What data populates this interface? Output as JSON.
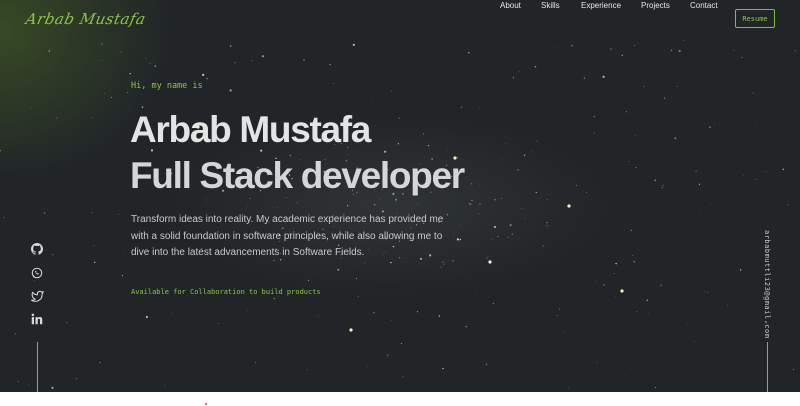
{
  "header": {
    "logo_text": "Arbab Mustafa",
    "nav": [
      "About",
      "Skills",
      "Experience",
      "Projects",
      "Contact"
    ],
    "resume_label": "Resume"
  },
  "hero": {
    "greeting": "Hi, my name is",
    "name": "Arbab Mustafa",
    "role": "Full Stack developer",
    "bio": "Transform ideas into reality. My academic experience has provided me with a solid foundation in software principles, while also allowing me to dive into the latest advancements in Software Fields.",
    "collab": "Available for Collaboration to build products"
  },
  "social": {
    "icons": [
      "github-icon",
      "whatsapp-icon",
      "twitter-icon",
      "linkedin-icon"
    ]
  },
  "email": "arbabmuttli23@gmail.com",
  "colors": {
    "accent": "#8bc34a",
    "background": "#212528",
    "text": "#e4e4e4"
  }
}
